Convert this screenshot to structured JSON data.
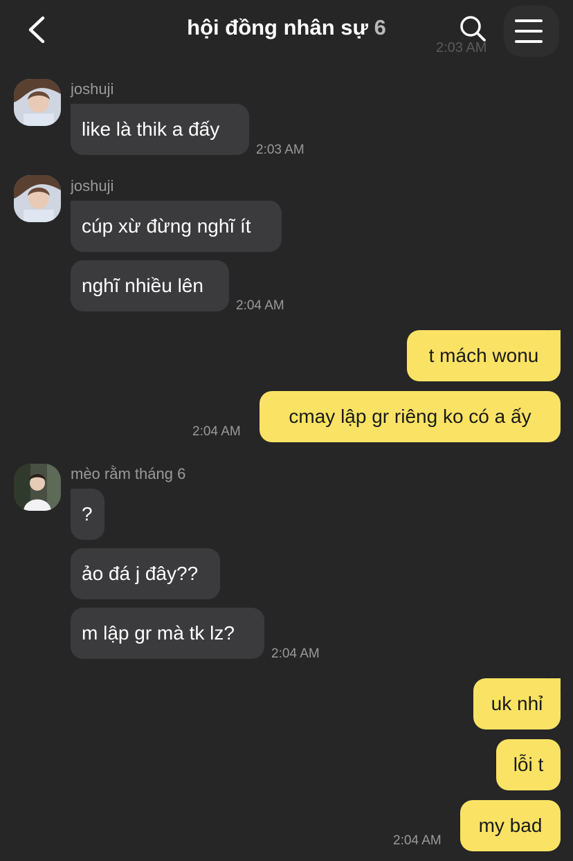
{
  "header": {
    "title": "hội đồng nhân sự",
    "member_count": "6",
    "faded_time": "2:03 AM"
  },
  "messages": {
    "g1_sender": "joshuji",
    "g1_m1": "like là thik a đấy",
    "g1_time": "2:03 AM",
    "g2_sender": "joshuji",
    "g2_m1": "cúp xừ đừng nghĩ ít",
    "g2_m2": "nghĩ nhiều lên",
    "g2_time": "2:04 AM",
    "o1_m1": "t mách wonu",
    "o1_m2": "cmay lập gr riêng ko có a ấy",
    "o1_time": "2:04 AM",
    "g3_sender": "mèo rằm tháng 6",
    "g3_m1": "?",
    "g3_m2": "ảo đá j đây??",
    "g3_m3": "m lập gr mà tk lz?",
    "g3_time": "2:04 AM",
    "o2_m1": "uk nhỉ",
    "o2_m2": "lỗi t",
    "o2_m3": "my bad",
    "o2_time": "2:04 AM"
  },
  "colors": {
    "background": "#262626",
    "incoming_bubble": "#3b3b3d",
    "outgoing_bubble": "#fae364",
    "muted_text": "#9a9a9a"
  },
  "icons": [
    "back-arrow-icon",
    "search-icon",
    "menu-icon"
  ]
}
